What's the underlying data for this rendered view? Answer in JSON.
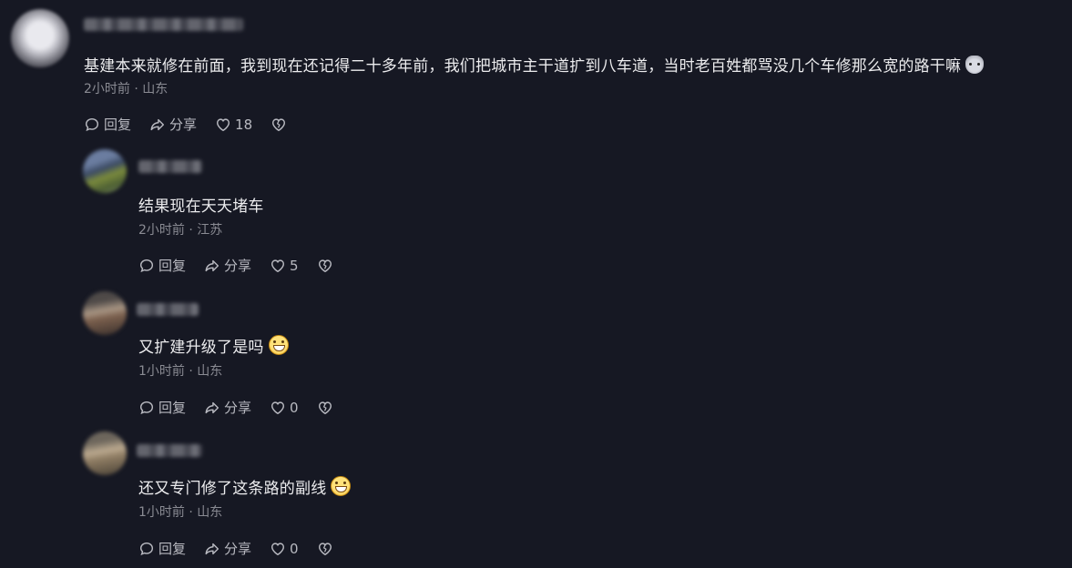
{
  "comments": [
    {
      "text": "基建本来就修在前面，我到现在还记得二十多年前，我们把城市主干道扩到八车道，当时老百姓都骂没几个车修那么宽的路干嘛",
      "emoji": "cat-face",
      "time": "2小时前",
      "location": "山东",
      "reply_label": "回复",
      "share_label": "分享",
      "likes": "18"
    }
  ],
  "replies": [
    {
      "text": "结果现在天天堵车",
      "time": "2小时前",
      "location": "江苏",
      "reply_label": "回复",
      "share_label": "分享",
      "likes": "5"
    },
    {
      "text": "又扩建升级了是吗",
      "emoji": "grinning-face",
      "time": "1小时前",
      "location": "山东",
      "reply_label": "回复",
      "share_label": "分享",
      "likes": "0"
    },
    {
      "text": "还又专门修了这条路的副线",
      "emoji": "grinning-face",
      "time": "1小时前",
      "location": "山东",
      "reply_label": "回复",
      "share_label": "分享",
      "likes": "0"
    }
  ],
  "separator": "·",
  "icons": {
    "reply": "speech-bubble-icon",
    "share": "share-arrow-icon",
    "like": "heart-icon",
    "dislike": "broken-heart-icon"
  },
  "colors": {
    "background": "#161823",
    "text": "#ececee",
    "meta": "#8a8b93"
  }
}
